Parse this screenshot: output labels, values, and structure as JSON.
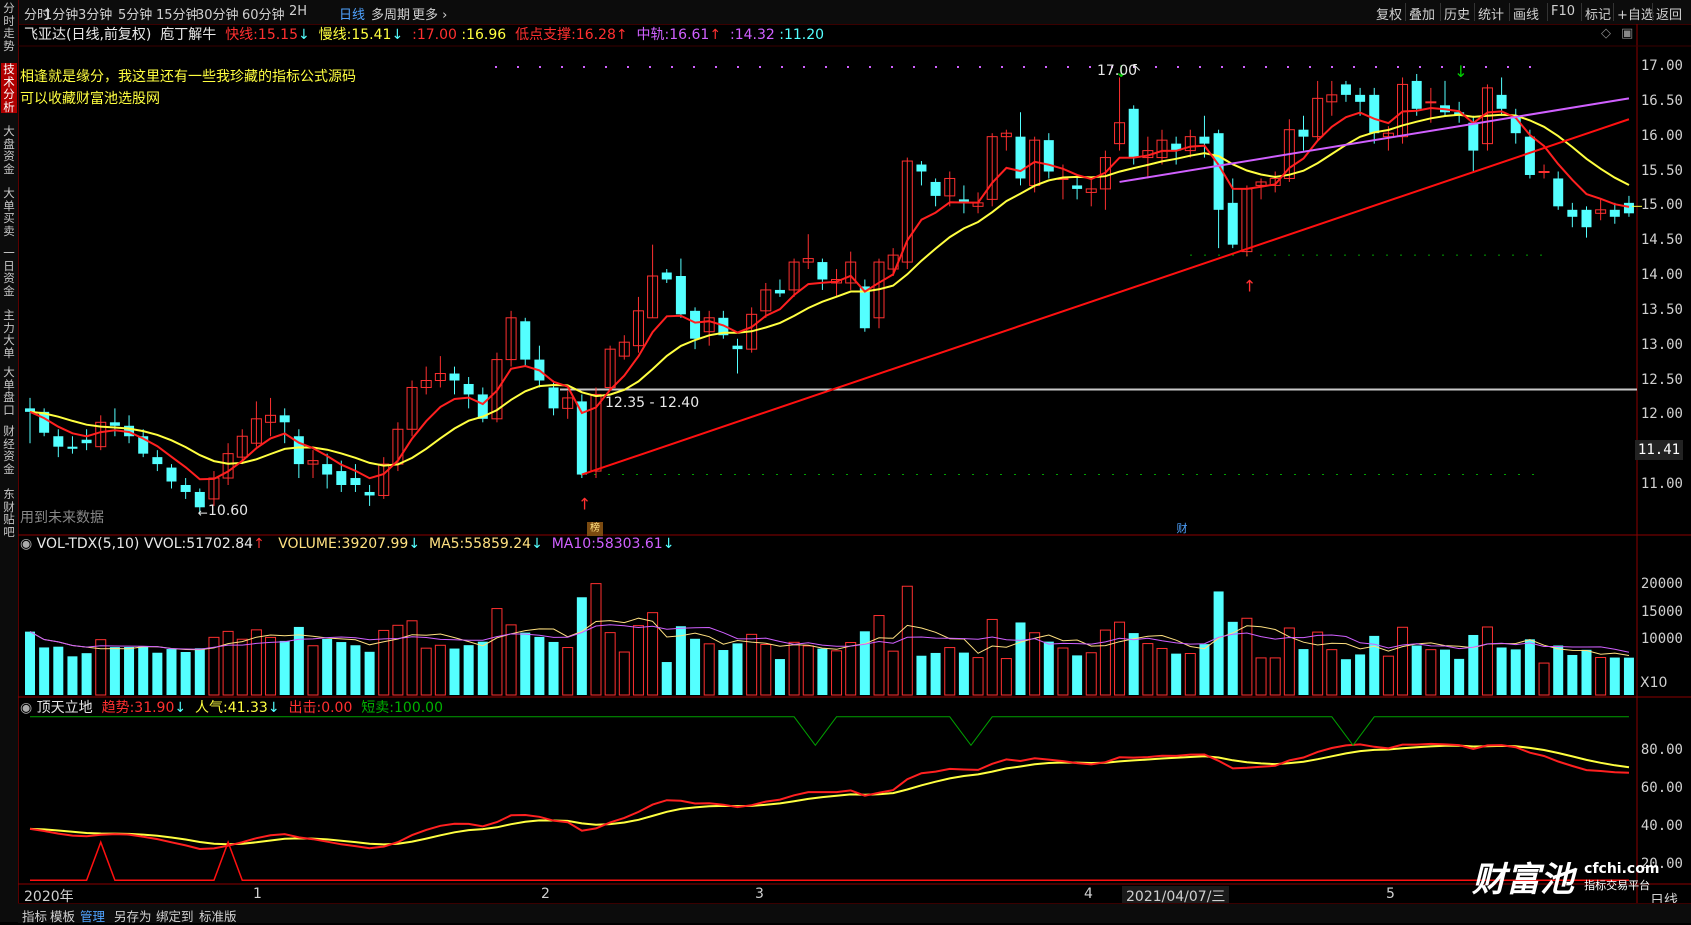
{
  "toolbar": {
    "periods": [
      "分时",
      "1分钟",
      "3分钟",
      "5分钟",
      "15分钟",
      "30分钟",
      "60分钟",
      "2H",
      "日线",
      "多周期",
      "更多"
    ],
    "active_period": "日线",
    "more_arrow": "›",
    "right_items": [
      "复权",
      "叠加",
      "历史",
      "统计",
      "画线",
      "F10",
      "标记",
      "+自选",
      "返回"
    ]
  },
  "left_tabs": [
    "分时走势",
    "技术分析",
    "大盘资金",
    "大单买卖",
    "一日资金",
    "主力大单",
    "大单盘口",
    "财经资金",
    "东财贴吧"
  ],
  "left_active": "技术分析",
  "main_info": {
    "title": "飞亚达(日线,前复权)",
    "indicator": "庖丁解牛",
    "fast_label": "快线:",
    "fast_value": "15.15",
    "fast_arrow": "↓",
    "slow_label": "慢线:",
    "slow_value": "15.41",
    "slow_arrow": "↓",
    "v1_label": ":",
    "v1_value": "17.00",
    "v2_label": ":",
    "v2_value": "16.96",
    "support_label": "低点支撑:",
    "support_value": "16.28",
    "support_arrow": "↑",
    "mid_label": "中轨:",
    "mid_value": "16.61",
    "mid_arrow": "↑",
    "v3_label": ":",
    "v3_value": "14.32",
    "v4_label": ":",
    "v4_value": "11.20"
  },
  "ad_text": [
    "相逢就是缘分，我这里还有一些我珍藏的指标公式源码",
    "可以收藏财富池选股网"
  ],
  "annotations": {
    "high": "17.00",
    "low": "10.60",
    "range": "12.35 - 12.40",
    "future_data": "用到未来数据",
    "badge1": "榜",
    "badge2": "财"
  },
  "price_axis": [
    "17.00",
    "16.50",
    "16.00",
    "15.50",
    "15.00",
    "14.50",
    "14.00",
    "13.50",
    "13.00",
    "12.50",
    "12.00",
    "11.50",
    "11.00"
  ],
  "current_price": "11.41",
  "vol_info": {
    "name": "VOL-TDX(5,10)",
    "vvol_label": "VVOL:",
    "vvol_value": "51702.84",
    "vvol_arrow": "↑",
    "volume_label": "VOLUME:",
    "volume_value": "39207.99",
    "volume_arrow": "↓",
    "ma5_label": "MA5:",
    "ma5_value": "55859.24",
    "ma5_arrow": "↓",
    "ma10_label": "MA10:",
    "ma10_value": "58303.61",
    "ma10_arrow": "↓"
  },
  "vol_axis": [
    "20000",
    "15000",
    "10000"
  ],
  "vol_unit": "X10",
  "osc_info": {
    "name": "顶天立地",
    "trend_label": "趋势:",
    "trend_value": "31.90",
    "trend_arrow": "↓",
    "pop_label": "人气:",
    "pop_value": "41.33",
    "pop_arrow": "↓",
    "out_label": "出击:",
    "out_value": "0.00",
    "short_label": "短卖:",
    "short_value": "100.00"
  },
  "osc_axis": [
    "80.00",
    "60.00",
    "40.00",
    "20.00"
  ],
  "x_axis": {
    "year": "2020年",
    "m1": "1",
    "m2": "2",
    "m3": "3",
    "m4": "4",
    "cursor_date": "2021/04/07/三",
    "m5": "5"
  },
  "period_label": "日线",
  "bottom_tabs": [
    "指标",
    "模板",
    "管理",
    "另存为",
    "绑定到",
    "标准版"
  ],
  "bottom_active": "管理",
  "watermark": {
    "brand": "财富池",
    "site": "cfchi.com",
    "slogan": "指标交易平台"
  },
  "colors": {
    "up": "#ff3030",
    "down": "#54ffff",
    "fast": "#ff2020",
    "slow": "#ffff40",
    "mid": "#d060ff",
    "ma5": "#ffe080",
    "ma10": "#d060ff",
    "green": "#00d000"
  },
  "chart_data": [
    {
      "type": "candlestick",
      "title": "飞亚达(日线,前复权)",
      "ylim": [
        10.4,
        17.2
      ],
      "candles": [
        {
          "o": 12.1,
          "c": 12.05,
          "h": 12.25,
          "l": 11.6
        },
        {
          "o": 12.05,
          "c": 11.75,
          "h": 12.1,
          "l": 11.7
        },
        {
          "o": 11.7,
          "c": 11.55,
          "h": 11.8,
          "l": 11.4
        },
        {
          "o": 11.55,
          "c": 11.52,
          "h": 11.7,
          "l": 11.45
        },
        {
          "o": 11.65,
          "c": 11.6,
          "h": 11.8,
          "l": 11.5
        },
        {
          "o": 11.55,
          "c": 11.9,
          "h": 12.0,
          "l": 11.5
        },
        {
          "o": 11.9,
          "c": 11.85,
          "h": 12.1,
          "l": 11.7
        },
        {
          "o": 11.85,
          "c": 11.7,
          "h": 12.0,
          "l": 11.6
        },
        {
          "o": 11.7,
          "c": 11.45,
          "h": 11.8,
          "l": 11.4
        },
        {
          "o": 11.4,
          "c": 11.3,
          "h": 11.5,
          "l": 11.2
        },
        {
          "o": 11.25,
          "c": 11.05,
          "h": 11.3,
          "l": 10.95
        },
        {
          "o": 11.0,
          "c": 10.9,
          "h": 11.1,
          "l": 10.8
        },
        {
          "o": 10.9,
          "c": 10.68,
          "h": 10.95,
          "l": 10.6
        },
        {
          "o": 10.8,
          "c": 11.1,
          "h": 11.2,
          "l": 10.7
        },
        {
          "o": 11.1,
          "c": 11.45,
          "h": 11.6,
          "l": 11.0
        },
        {
          "o": 11.4,
          "c": 11.7,
          "h": 11.8,
          "l": 11.3
        },
        {
          "o": 11.6,
          "c": 11.95,
          "h": 12.2,
          "l": 11.55
        },
        {
          "o": 11.9,
          "c": 12.0,
          "h": 12.25,
          "l": 11.7
        },
        {
          "o": 12.0,
          "c": 11.9,
          "h": 12.1,
          "l": 11.6
        },
        {
          "o": 11.7,
          "c": 11.3,
          "h": 11.8,
          "l": 11.1
        },
        {
          "o": 11.3,
          "c": 11.35,
          "h": 11.5,
          "l": 11.1
        },
        {
          "o": 11.3,
          "c": 11.15,
          "h": 11.45,
          "l": 10.95
        },
        {
          "o": 11.2,
          "c": 11.0,
          "h": 11.35,
          "l": 10.9
        },
        {
          "o": 11.1,
          "c": 11.0,
          "h": 11.3,
          "l": 10.9
        },
        {
          "o": 10.9,
          "c": 10.85,
          "h": 11.0,
          "l": 10.7
        },
        {
          "o": 10.85,
          "c": 11.3,
          "h": 11.4,
          "l": 10.8
        },
        {
          "o": 11.3,
          "c": 11.8,
          "h": 11.9,
          "l": 11.2
        },
        {
          "o": 11.8,
          "c": 12.4,
          "h": 12.5,
          "l": 11.7
        },
        {
          "o": 12.4,
          "c": 12.5,
          "h": 12.7,
          "l": 12.3
        },
        {
          "o": 12.5,
          "c": 12.6,
          "h": 12.85,
          "l": 12.4
        },
        {
          "o": 12.6,
          "c": 12.5,
          "h": 12.7,
          "l": 12.3
        },
        {
          "o": 12.45,
          "c": 12.3,
          "h": 12.55,
          "l": 12.1
        },
        {
          "o": 12.3,
          "c": 11.95,
          "h": 12.4,
          "l": 11.9
        },
        {
          "o": 11.95,
          "c": 12.8,
          "h": 12.9,
          "l": 11.9
        },
        {
          "o": 12.8,
          "c": 13.4,
          "h": 13.5,
          "l": 12.7
        },
        {
          "o": 13.35,
          "c": 12.8,
          "h": 13.4,
          "l": 12.7
        },
        {
          "o": 12.8,
          "c": 12.5,
          "h": 13.0,
          "l": 12.4
        },
        {
          "o": 12.4,
          "c": 12.1,
          "h": 12.5,
          "l": 12.0
        },
        {
          "o": 12.1,
          "c": 12.25,
          "h": 12.35,
          "l": 11.95
        },
        {
          "o": 12.2,
          "c": 11.15,
          "h": 12.3,
          "l": 11.1
        },
        {
          "o": 11.2,
          "c": 12.3,
          "h": 12.4,
          "l": 11.1
        },
        {
          "o": 12.4,
          "c": 12.95,
          "h": 13.0,
          "l": 12.35
        },
        {
          "o": 12.85,
          "c": 13.05,
          "h": 13.15,
          "l": 12.8
        },
        {
          "o": 13.0,
          "c": 13.5,
          "h": 13.7,
          "l": 12.9
        },
        {
          "o": 13.4,
          "c": 14.0,
          "h": 14.45,
          "l": 13.4
        },
        {
          "o": 14.05,
          "c": 13.95,
          "h": 14.1,
          "l": 13.9
        },
        {
          "o": 14.0,
          "c": 13.45,
          "h": 14.25,
          "l": 13.4
        },
        {
          "o": 13.5,
          "c": 13.1,
          "h": 13.55,
          "l": 12.95
        },
        {
          "o": 13.2,
          "c": 13.4,
          "h": 13.5,
          "l": 13.0
        },
        {
          "o": 13.4,
          "c": 13.15,
          "h": 13.5,
          "l": 13.1
        },
        {
          "o": 13.0,
          "c": 12.95,
          "h": 13.1,
          "l": 12.6
        },
        {
          "o": 12.95,
          "c": 13.45,
          "h": 13.55,
          "l": 12.9
        },
        {
          "o": 13.5,
          "c": 13.8,
          "h": 13.9,
          "l": 13.4
        },
        {
          "o": 13.8,
          "c": 13.75,
          "h": 13.95,
          "l": 13.7
        },
        {
          "o": 13.8,
          "c": 14.2,
          "h": 14.25,
          "l": 13.7
        },
        {
          "o": 14.2,
          "c": 14.25,
          "h": 14.6,
          "l": 14.1
        },
        {
          "o": 14.2,
          "c": 13.95,
          "h": 14.25,
          "l": 13.8
        },
        {
          "o": 13.9,
          "c": 13.95,
          "h": 14.1,
          "l": 13.7
        },
        {
          "o": 13.9,
          "c": 14.2,
          "h": 14.35,
          "l": 13.8
        },
        {
          "o": 13.85,
          "c": 13.25,
          "h": 13.95,
          "l": 13.2
        },
        {
          "o": 13.4,
          "c": 14.2,
          "h": 14.25,
          "l": 13.25
        },
        {
          "o": 14.1,
          "c": 14.3,
          "h": 14.4,
          "l": 14.0
        },
        {
          "o": 14.2,
          "c": 15.65,
          "h": 15.7,
          "l": 14.1
        },
        {
          "o": 15.6,
          "c": 15.5,
          "h": 15.65,
          "l": 15.3
        },
        {
          "o": 15.35,
          "c": 15.15,
          "h": 15.4,
          "l": 15.0
        },
        {
          "o": 15.15,
          "c": 15.4,
          "h": 15.5,
          "l": 15.0
        },
        {
          "o": 15.1,
          "c": 15.05,
          "h": 15.3,
          "l": 14.9
        },
        {
          "o": 15.0,
          "c": 15.05,
          "h": 15.2,
          "l": 14.9
        },
        {
          "o": 15.1,
          "c": 16.0,
          "h": 16.05,
          "l": 15.0
        },
        {
          "o": 16.0,
          "c": 16.05,
          "h": 16.1,
          "l": 15.8
        },
        {
          "o": 16.0,
          "c": 15.4,
          "h": 16.35,
          "l": 15.3
        },
        {
          "o": 15.3,
          "c": 15.95,
          "h": 16.0,
          "l": 15.2
        },
        {
          "o": 15.95,
          "c": 15.5,
          "h": 16.05,
          "l": 15.4
        },
        {
          "o": 15.4,
          "c": 15.4,
          "h": 15.6,
          "l": 15.1
        },
        {
          "o": 15.3,
          "c": 15.25,
          "h": 15.45,
          "l": 15.1
        },
        {
          "o": 15.2,
          "c": 15.25,
          "h": 15.4,
          "l": 15.0
        },
        {
          "o": 15.25,
          "c": 15.7,
          "h": 15.8,
          "l": 14.95
        },
        {
          "o": 15.9,
          "c": 16.2,
          "h": 16.85,
          "l": 15.8
        },
        {
          "o": 16.4,
          "c": 15.7,
          "h": 16.45,
          "l": 15.6
        },
        {
          "o": 15.7,
          "c": 15.8,
          "h": 16.0,
          "l": 15.4
        },
        {
          "o": 15.7,
          "c": 15.95,
          "h": 16.1,
          "l": 15.6
        },
        {
          "o": 15.9,
          "c": 15.8,
          "h": 16.0,
          "l": 15.6
        },
        {
          "o": 15.8,
          "c": 16.0,
          "h": 16.1,
          "l": 15.7
        },
        {
          "o": 16.0,
          "c": 15.9,
          "h": 16.3,
          "l": 15.7
        },
        {
          "o": 16.05,
          "c": 14.95,
          "h": 16.1,
          "l": 14.4
        },
        {
          "o": 15.05,
          "c": 14.45,
          "h": 15.4,
          "l": 14.4
        },
        {
          "o": 14.35,
          "c": 15.25,
          "h": 15.3,
          "l": 14.28
        },
        {
          "o": 15.3,
          "c": 15.35,
          "h": 15.4,
          "l": 15.1
        },
        {
          "o": 15.3,
          "c": 15.4,
          "h": 15.5,
          "l": 15.2
        },
        {
          "o": 15.4,
          "c": 16.1,
          "h": 16.25,
          "l": 15.35
        },
        {
          "o": 16.1,
          "c": 16.0,
          "h": 16.3,
          "l": 15.8
        },
        {
          "o": 16.0,
          "c": 16.55,
          "h": 16.8,
          "l": 15.95
        },
        {
          "o": 16.5,
          "c": 16.6,
          "h": 16.8,
          "l": 16.3
        },
        {
          "o": 16.75,
          "c": 16.6,
          "h": 16.8,
          "l": 16.5
        },
        {
          "o": 16.6,
          "c": 16.5,
          "h": 16.7,
          "l": 16.3
        },
        {
          "o": 16.6,
          "c": 16.05,
          "h": 16.7,
          "l": 15.9
        },
        {
          "o": 16.0,
          "c": 16.05,
          "h": 16.15,
          "l": 15.8
        },
        {
          "o": 16.0,
          "c": 16.75,
          "h": 16.85,
          "l": 15.9
        },
        {
          "o": 16.8,
          "c": 16.4,
          "h": 16.9,
          "l": 16.3
        },
        {
          "o": 16.5,
          "c": 16.5,
          "h": 16.7,
          "l": 16.2
        },
        {
          "o": 16.45,
          "c": 16.35,
          "h": 16.8,
          "l": 16.3
        },
        {
          "o": 16.35,
          "c": 16.3,
          "h": 16.5,
          "l": 16.2
        },
        {
          "o": 16.2,
          "c": 15.8,
          "h": 16.3,
          "l": 15.5
        },
        {
          "o": 15.9,
          "c": 16.7,
          "h": 16.75,
          "l": 15.8
        },
        {
          "o": 16.6,
          "c": 16.4,
          "h": 16.85,
          "l": 16.3
        },
        {
          "o": 16.3,
          "c": 16.05,
          "h": 16.4,
          "l": 15.9
        },
        {
          "o": 16.0,
          "c": 15.45,
          "h": 16.1,
          "l": 15.4
        },
        {
          "o": 15.5,
          "c": 15.5,
          "h": 15.6,
          "l": 15.4
        },
        {
          "o": 15.4,
          "c": 15.0,
          "h": 15.5,
          "l": 14.95
        },
        {
          "o": 14.95,
          "c": 14.85,
          "h": 15.05,
          "l": 14.7
        },
        {
          "o": 14.95,
          "c": 14.7,
          "h": 15.0,
          "l": 14.55
        },
        {
          "o": 14.9,
          "c": 14.95,
          "h": 15.1,
          "l": 14.8
        },
        {
          "o": 14.95,
          "c": 14.85,
          "h": 15.05,
          "l": 14.75
        },
        {
          "o": 15.05,
          "c": 14.9,
          "h": 15.15,
          "l": 14.85
        }
      ]
    },
    {
      "type": "bar",
      "title": "VOL-TDX(5,10)",
      "ylim": [
        0,
        25000
      ]
    },
    {
      "type": "line",
      "title": "顶天立地",
      "ylim": [
        10,
        100
      ]
    }
  ]
}
